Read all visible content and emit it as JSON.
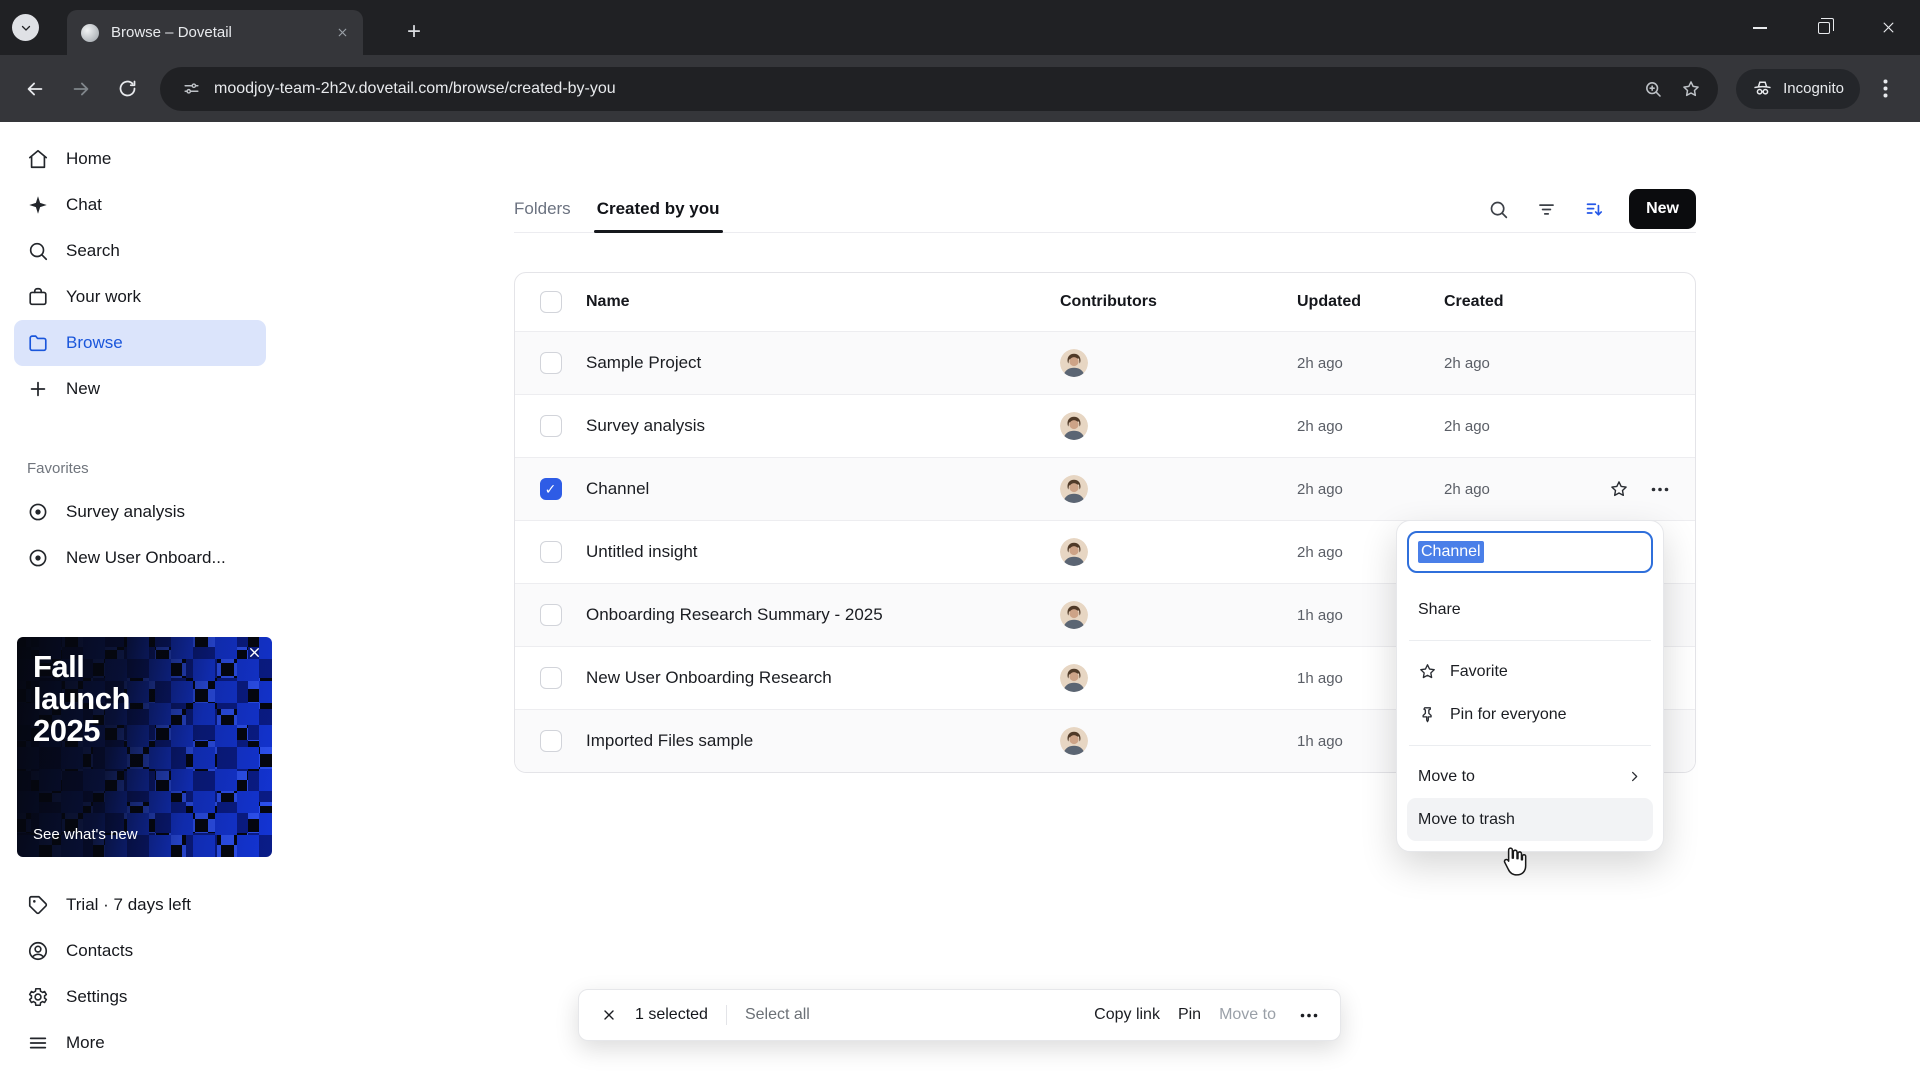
{
  "browser": {
    "tab_title": "Browse – Dovetail",
    "url": "moodjoy-team-2h2v.dovetail.com/browse/created-by-you",
    "incognito_label": "Incognito"
  },
  "sidebar": {
    "items": [
      {
        "label": "Home",
        "icon": "home-icon"
      },
      {
        "label": "Chat",
        "icon": "sparkle-icon"
      },
      {
        "label": "Search",
        "icon": "search-icon"
      },
      {
        "label": "Your work",
        "icon": "briefcase-icon"
      },
      {
        "label": "Browse",
        "icon": "folder-icon",
        "active": true
      },
      {
        "label": "New",
        "icon": "plus-icon"
      }
    ],
    "favorites_title": "Favorites",
    "favorites": [
      {
        "label": "Survey analysis",
        "icon": "target-icon"
      },
      {
        "label": "New User Onboard...",
        "icon": "target-icon"
      }
    ],
    "promo": {
      "title": "Fall launch 2025",
      "cta": "See what's new"
    },
    "footer": [
      {
        "label": "Trial · 7 days left",
        "icon": "tag-icon"
      },
      {
        "label": "Contacts",
        "icon": "person-icon"
      },
      {
        "label": "Settings",
        "icon": "gear-icon"
      },
      {
        "label": "More",
        "icon": "menu-icon"
      }
    ]
  },
  "main": {
    "tabs": [
      {
        "label": "Folders",
        "active": false
      },
      {
        "label": "Created by you",
        "active": true
      }
    ],
    "new_button_label": "New",
    "table": {
      "columns": [
        "Name",
        "Contributors",
        "Updated",
        "Created"
      ],
      "rows": [
        {
          "name": "Sample Project",
          "updated": "2h ago",
          "created": "2h ago",
          "checked": false
        },
        {
          "name": "Survey analysis",
          "updated": "2h ago",
          "created": "2h ago",
          "checked": false
        },
        {
          "name": "Channel",
          "updated": "2h ago",
          "created": "2h ago",
          "checked": true
        },
        {
          "name": "Untitled insight",
          "updated": "2h ago",
          "created": "",
          "checked": false
        },
        {
          "name": "Onboarding Research Summary - 2025",
          "updated": "1h ago",
          "created": "",
          "checked": false
        },
        {
          "name": "New User Onboarding Research",
          "updated": "1h ago",
          "created": "",
          "checked": false
        },
        {
          "name": "Imported Files sample",
          "updated": "1h ago",
          "created": "",
          "checked": false
        }
      ]
    }
  },
  "context_menu": {
    "rename_value": "Channel",
    "share_label": "Share",
    "favorite_label": "Favorite",
    "pin_label": "Pin for everyone",
    "move_to_label": "Move to",
    "move_to_trash_label": "Move to trash"
  },
  "selection_bar": {
    "selected_count": "1 selected",
    "select_all_label": "Select all",
    "copy_link_label": "Copy link",
    "pin_label": "Pin",
    "move_to_label": "Move to"
  },
  "colors": {
    "accent": "#1a56db",
    "checkbox_checked": "#2e5ce6",
    "selection_highlight": "#4a7fe8",
    "new_button_bg": "#0b0c0e",
    "chrome_dark": "#202124",
    "chrome_toolbar": "#35363a"
  }
}
